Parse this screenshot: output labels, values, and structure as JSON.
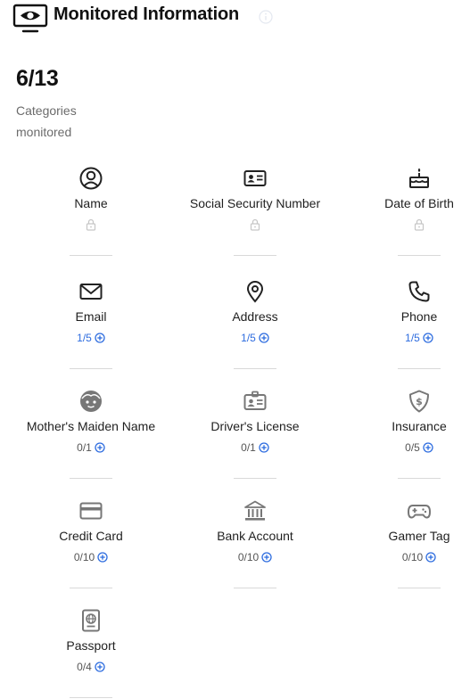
{
  "header": {
    "title": "Monitored Information",
    "icon": "monitor-eye-icon",
    "info_icon": "info-icon"
  },
  "summary": {
    "count": "6/13",
    "caption_line1": "Categories",
    "caption_line2": "monitored"
  },
  "colors": {
    "accent": "#2d6cdf",
    "text": "#1f1f1f",
    "muted": "#6b6b6b",
    "divider": "#d9d9d9"
  },
  "categories": [
    {
      "label": "Name",
      "icon": "person-circle-icon",
      "locked": true,
      "status": ""
    },
    {
      "label": "Social Security Number",
      "icon": "id-card-icon",
      "locked": true,
      "status": ""
    },
    {
      "label": "Date of Birth",
      "icon": "birthday-cake-icon",
      "locked": true,
      "status": ""
    },
    {
      "label": "Email",
      "icon": "envelope-icon",
      "locked": false,
      "status": "1/5"
    },
    {
      "label": "Address",
      "icon": "map-pin-icon",
      "locked": false,
      "status": "1/5"
    },
    {
      "label": "Phone",
      "icon": "phone-icon",
      "locked": false,
      "status": "1/5"
    },
    {
      "label": "Mother's Maiden Name",
      "icon": "face-icon",
      "locked": false,
      "status": "0/1"
    },
    {
      "label": "Driver's License",
      "icon": "badge-icon",
      "locked": false,
      "status": "0/1"
    },
    {
      "label": "Insurance",
      "icon": "shield-dollar-icon",
      "locked": false,
      "status": "0/5"
    },
    {
      "label": "Credit Card",
      "icon": "credit-card-icon",
      "locked": false,
      "status": "0/10"
    },
    {
      "label": "Bank Account",
      "icon": "bank-icon",
      "locked": false,
      "status": "0/10"
    },
    {
      "label": "Gamer Tag",
      "icon": "gamepad-icon",
      "locked": false,
      "status": "0/10"
    },
    {
      "label": "Passport",
      "icon": "passport-icon",
      "locked": false,
      "status": "0/4"
    }
  ]
}
